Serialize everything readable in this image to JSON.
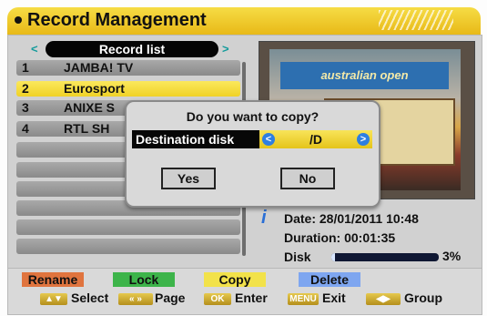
{
  "header": {
    "title": "Record Management"
  },
  "list": {
    "header": "Record list",
    "nav_left": "<",
    "nav_right": ">",
    "items": [
      {
        "num": "1",
        "name": "JAMBA! TV"
      },
      {
        "num": "2",
        "name": "Eurosport"
      },
      {
        "num": "3",
        "name": "ANIXE S"
      },
      {
        "num": "4",
        "name": "RTL SH"
      }
    ]
  },
  "preview": {
    "banner": "australian open"
  },
  "info": {
    "icon": "info-icon",
    "date": "Date:  28/01/2011  10:48",
    "duration": "Duration:  00:01:35",
    "disk_label": "Disk",
    "disk_percent": "3%",
    "disk_fraction": 0.03
  },
  "dialog": {
    "question": "Do you want to copy?",
    "dest_label": "Destination disk",
    "dest_value": "/D",
    "arrow_left": "<",
    "arrow_right": ">",
    "yes": "Yes",
    "no": "No"
  },
  "color_buttons": {
    "rename": "Rename",
    "lock": "Lock",
    "copy": "Copy",
    "delete": "Delete",
    "colors": {
      "red": "#e0743e",
      "green": "#3db44a",
      "yellow": "#f2e24a",
      "blue": "#7ea6f0"
    }
  },
  "hints": {
    "select": "Select",
    "page": "Page",
    "enter": "Enter",
    "exit": "Exit",
    "group": "Group",
    "key_ok": "OK",
    "key_menu": "MENU"
  }
}
